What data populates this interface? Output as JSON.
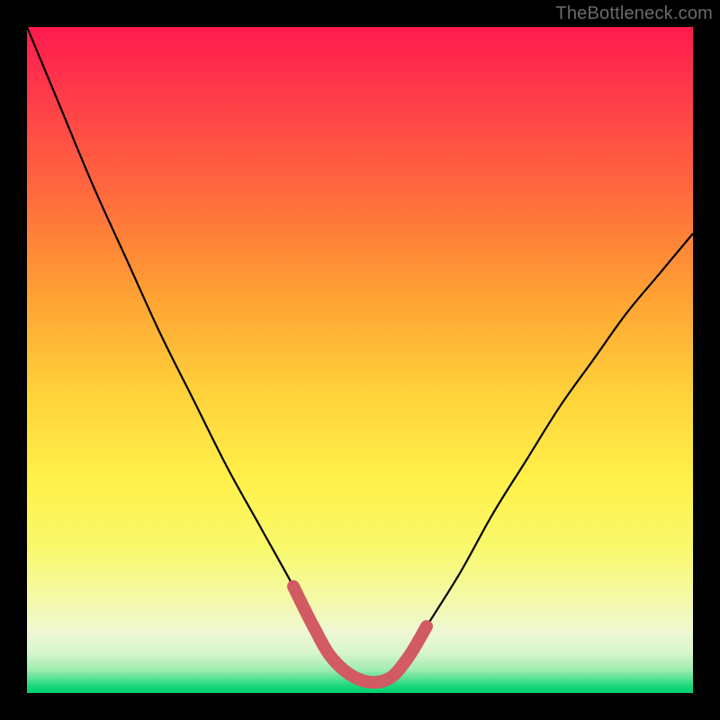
{
  "watermark": "TheBottleneck.com",
  "chart_data": {
    "type": "line",
    "title": "",
    "xlabel": "",
    "ylabel": "",
    "xlim": [
      0,
      100
    ],
    "ylim": [
      0,
      100
    ],
    "series": [
      {
        "name": "bottleneck-curve",
        "x": [
          0,
          5,
          10,
          15,
          20,
          25,
          30,
          35,
          40,
          43,
          46,
          50,
          54,
          57,
          60,
          65,
          70,
          75,
          80,
          85,
          90,
          95,
          100
        ],
        "values": [
          100,
          88,
          76,
          65,
          54,
          44,
          34,
          25,
          16,
          10,
          5,
          2,
          2,
          5,
          10,
          18,
          27,
          35,
          43,
          50,
          57,
          63,
          69
        ]
      }
    ],
    "highlight": {
      "name": "optimal-range",
      "x": [
        40,
        43,
        46,
        50,
        54,
        57,
        60
      ],
      "values": [
        16,
        10,
        5,
        2,
        2,
        5,
        10
      ],
      "color": "#d15a63"
    },
    "background_gradient": {
      "top": "#ff1a4d",
      "mid": "#fff04a",
      "bottom": "#00cf72"
    }
  }
}
